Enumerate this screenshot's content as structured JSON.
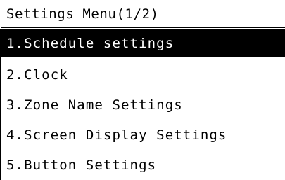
{
  "menu": {
    "title": "Settings Menu(1/2)",
    "items": [
      {
        "label": "1.Schedule settings",
        "selected": true
      },
      {
        "label": "2.Clock",
        "selected": false
      },
      {
        "label": "3.Zone Name Settings",
        "selected": false
      },
      {
        "label": "4.Screen Display Settings",
        "selected": false
      },
      {
        "label": "5.Button Settings",
        "selected": false
      }
    ]
  },
  "colors": {
    "background": "#ffffff",
    "text": "#000000",
    "highlight": "#000000",
    "highlight_text": "#ffffff"
  }
}
